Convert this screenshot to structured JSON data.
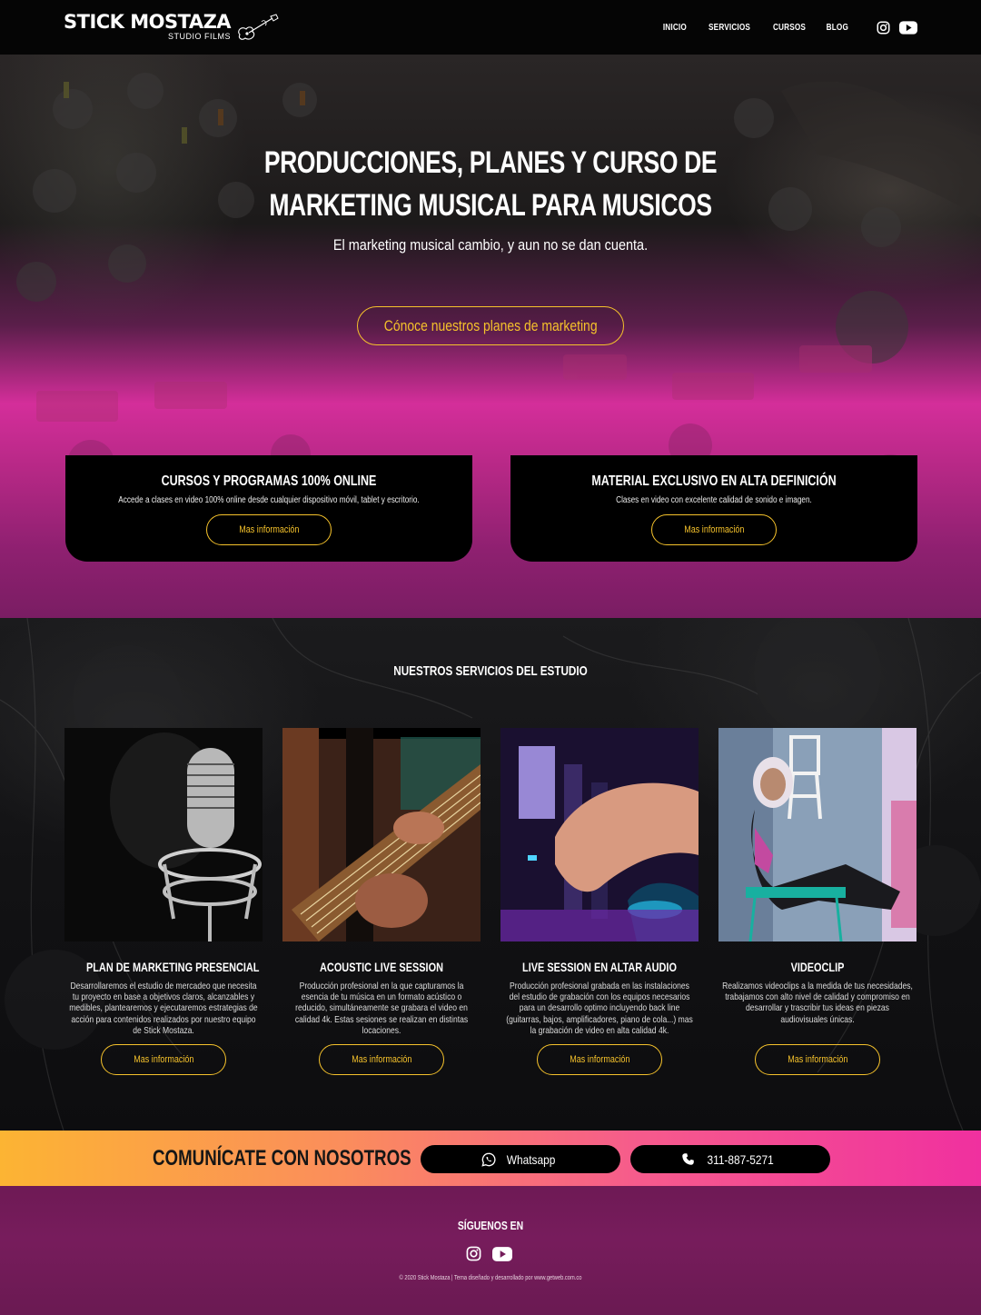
{
  "header": {
    "logo_main": "STICK MOSTAZA",
    "logo_sub": "STUDIO FILMS",
    "nav": [
      "INICIO",
      "SERVICIOS",
      "CURSOS",
      "BLOG"
    ],
    "social_icons": [
      "instagram-icon",
      "youtube-icon"
    ]
  },
  "hero": {
    "title_line1": "Producciones, planes y curso de",
    "title_line2": "marketing musical para musicos",
    "subtitle": "El marketing musical cambio, y aun no se dan cuenta.",
    "cta": "Cónoce nuestros planes de marketing"
  },
  "features": [
    {
      "title": "Cursos y programas 100% online",
      "text": "Accede a clases en video 100% online desde cualquier dispositivo móvil, tablet y escritorio.",
      "button": "Mas información"
    },
    {
      "title": "Material exclusivo en alta definición",
      "text": "Clases en video con excelente calidad de sonido e imagen.",
      "button": "Mas información"
    }
  ],
  "services": {
    "title": "Nuestros servicios del estudio",
    "items": [
      {
        "title": "Plan de marketing presencial",
        "text": "Desarrollaremos el estudio de mercadeo que necesita tu proyecto en base a objetivos claros, alcanzables y medibles, plantearemos y ejecutaremos estrategias de acción para contenidos realizados por nuestro equipo de Stick Mostaza.",
        "button": "Mas información",
        "image": "microphone-photo"
      },
      {
        "title": "Acoustic live session",
        "text": "Producción profesional en la que capturamos la esencia de tu música en un formato acústico o reducido, simultáneamente se grabara el video en calidad 4k. Estas sesiones se realizan en distintas locaciones.",
        "button": "Mas información",
        "image": "bass-guitar-photo"
      },
      {
        "title": "Live session en Altar Audio",
        "text": "Producción profesional grabada en las instalaciones del estudio de grabación con los equipos necesarios para un desarrollo optimo incluyendo back line (guitarras, bajos, amplificadores, piano de cola...) mas la grabación de video en alta calidad 4k.",
        "button": "Mas información",
        "image": "mixer-photo"
      },
      {
        "title": "Videoclip",
        "text": "Realizamos videoclips a la medida de tus necesidades, trabajamos con alto nivel de calidad y compromiso en desarrollar y trascribir tus ideas en piezas audiovisuales únicas.",
        "button": "Mas información",
        "image": "videoclip-photo"
      }
    ]
  },
  "contact": {
    "title": "Comunícate con nosotros",
    "whatsapp": "Whatsapp",
    "phone": "311-887-5271"
  },
  "footer": {
    "title": "SÍGUENOS EN",
    "copyright": "© 2020 Stick Mostaza | Tema diseñado y desarrollado por www.getweb.com.co"
  },
  "colors": {
    "accent": "#f5c22b",
    "pink": "#e0309a",
    "dark": "#050505"
  }
}
